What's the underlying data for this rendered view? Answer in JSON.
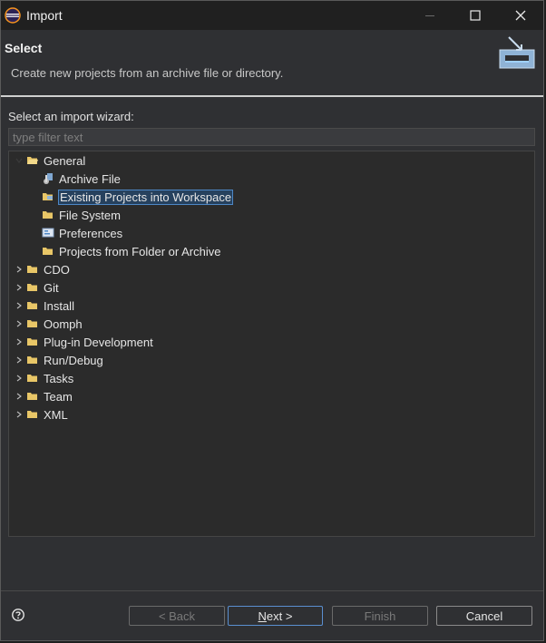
{
  "window": {
    "title": "Import"
  },
  "banner": {
    "title": "Select",
    "description": "Create new projects from an archive file or directory."
  },
  "wizard": {
    "label": "Select an import wizard:",
    "filter_placeholder": "type filter text"
  },
  "tree": {
    "general": {
      "label": "General",
      "children": [
        {
          "label": "Archive File",
          "icon": "archive-icon"
        },
        {
          "label": "Existing Projects into Workspace",
          "icon": "projects-icon",
          "selected": true
        },
        {
          "label": "File System",
          "icon": "folder-icon"
        },
        {
          "label": "Preferences",
          "icon": "preferences-icon"
        },
        {
          "label": "Projects from Folder or Archive",
          "icon": "folder-icon"
        }
      ]
    },
    "categories": [
      {
        "label": "CDO"
      },
      {
        "label": "Git"
      },
      {
        "label": "Install"
      },
      {
        "label": "Oomph"
      },
      {
        "label": "Plug-in Development"
      },
      {
        "label": "Run/Debug"
      },
      {
        "label": "Tasks"
      },
      {
        "label": "Team"
      },
      {
        "label": "XML"
      }
    ]
  },
  "buttons": {
    "back": "< Back",
    "next_mnemonic": "N",
    "next_rest": "ext >",
    "finish": "Finish",
    "cancel": "Cancel"
  },
  "colors": {
    "selection_bg": "#26415e",
    "selection_border": "#4d87c5",
    "folder": "#e8c667"
  }
}
